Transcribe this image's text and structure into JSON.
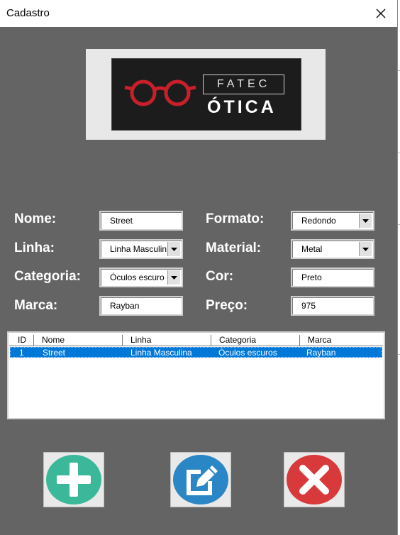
{
  "window": {
    "title": "Cadastro"
  },
  "logo": {
    "line1": "FATEC",
    "line2": "ÓTICA"
  },
  "form": {
    "nome": {
      "label": "Nome:",
      "value": "Street"
    },
    "linha": {
      "label": "Linha:",
      "value": "Linha Masculin"
    },
    "categoria": {
      "label": "Categoria:",
      "value": "Óculos escuro"
    },
    "marca": {
      "label": "Marca:",
      "value": "Rayban"
    },
    "formato": {
      "label": "Formato:",
      "value": "Redondo"
    },
    "material": {
      "label": "Material:",
      "value": "Metal"
    },
    "cor": {
      "label": "Cor:",
      "value": "Preto"
    },
    "preco": {
      "label": "Preço:",
      "value": "975"
    }
  },
  "list": {
    "columns": [
      "ID",
      "Nome",
      "Linha",
      "Categoria",
      "Marca"
    ],
    "rows": [
      {
        "id": "1",
        "nome": "Street",
        "linha": "Linha Masculina",
        "categoria": "Óculos escuros",
        "marca": "Rayban",
        "selected": true
      }
    ]
  },
  "buttons": [
    {
      "name": "add",
      "icon": "plus-icon",
      "color": "#3bb89a"
    },
    {
      "name": "edit",
      "icon": "edit-icon",
      "color": "#2b86c5"
    },
    {
      "name": "delete",
      "icon": "x-icon",
      "color": "#d8393a"
    }
  ],
  "colors": {
    "dialog_bg": "#646464",
    "selection": "#0078d7",
    "logo_red": "#c8202a"
  }
}
